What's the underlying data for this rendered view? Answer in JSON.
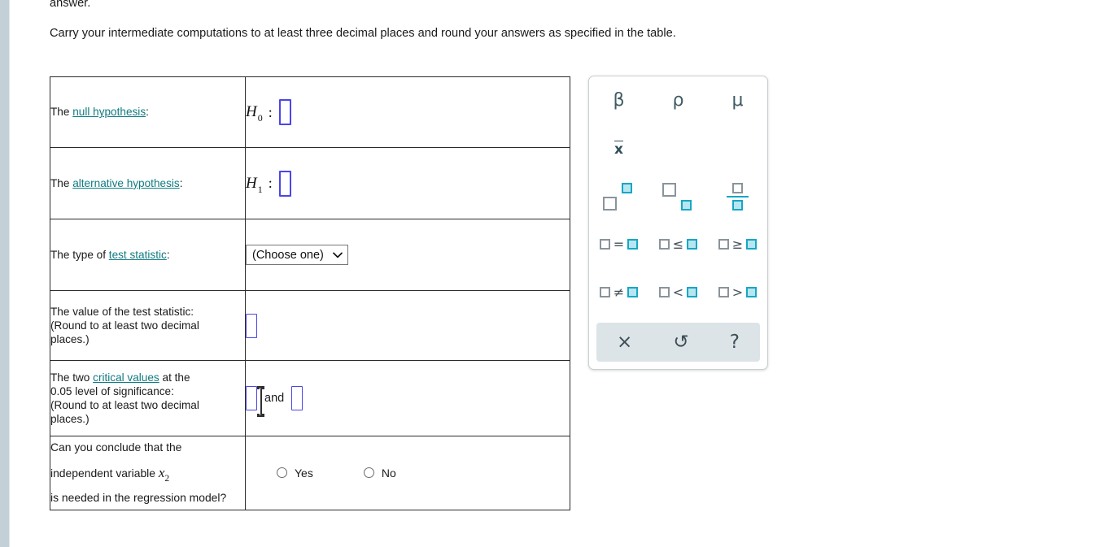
{
  "intro": {
    "line1": "answer.",
    "line2": "Carry your intermediate computations to at least three decimal places and round your answers as specified in the table."
  },
  "table": {
    "rows": [
      {
        "label_prefix": "The ",
        "label_link": "null hypothesis",
        "label_suffix": ":",
        "symbol": "H",
        "subscript": "0",
        "colon": ":"
      },
      {
        "label_prefix": "The ",
        "label_link": "alternative hypothesis",
        "label_suffix": ":",
        "symbol": "H",
        "subscript": "1",
        "colon": ":"
      },
      {
        "label_prefix": "The type of ",
        "label_link": "test statistic",
        "label_suffix": ":",
        "select_value": "(Choose one)",
        "select_chevron": "chevron-down-icon"
      },
      {
        "label_line1": "The value of the test statistic:",
        "label_line2": "(Round to at least two decimal",
        "label_line3": "places.)"
      },
      {
        "label_prefix": "The two ",
        "label_link": "critical values",
        "label_suffix": " at the",
        "label_line2": "0.05 level of significance:",
        "label_line3": "(Round to at least two decimal",
        "label_line4": "places.)",
        "conjunction": "and"
      },
      {
        "question_line1": "Can you conclude that the independent variable ",
        "question_var": "x",
        "question_var_sub": "2",
        "question_line2": "is needed in the regression model?",
        "options": [
          {
            "label": "Yes",
            "selected": false
          },
          {
            "label": "No",
            "selected": false
          }
        ]
      }
    ]
  },
  "palette": {
    "symbols": [
      {
        "name": "beta-symbol",
        "glyph": "β"
      },
      {
        "name": "rho-symbol",
        "glyph": "ρ"
      },
      {
        "name": "mu-symbol",
        "glyph": "μ"
      },
      {
        "name": "x-bar-symbol",
        "glyph": "x"
      }
    ],
    "templates": [
      {
        "name": "superscript-template"
      },
      {
        "name": "subscript-template"
      },
      {
        "name": "fraction-template"
      }
    ],
    "relations": [
      {
        "name": "equals-template",
        "op": "="
      },
      {
        "name": "less-than-or-equal-template",
        "op": "≤"
      },
      {
        "name": "greater-than-or-equal-template",
        "op": "≥"
      },
      {
        "name": "not-equal-template",
        "op": "≠"
      },
      {
        "name": "less-than-template",
        "op": "<"
      },
      {
        "name": "greater-than-template",
        "op": ">"
      }
    ],
    "footer": [
      {
        "name": "clear-button",
        "glyph": "×"
      },
      {
        "name": "undo-button",
        "glyph": "↺"
      },
      {
        "name": "help-button",
        "glyph": "?"
      }
    ]
  },
  "colors": {
    "link": "#0f7b82",
    "input_border": "#4a46e8",
    "palette_accent": "#17a7c4",
    "palette_symbol": "#3f5b63",
    "left_strip": "#c3d0d7"
  }
}
